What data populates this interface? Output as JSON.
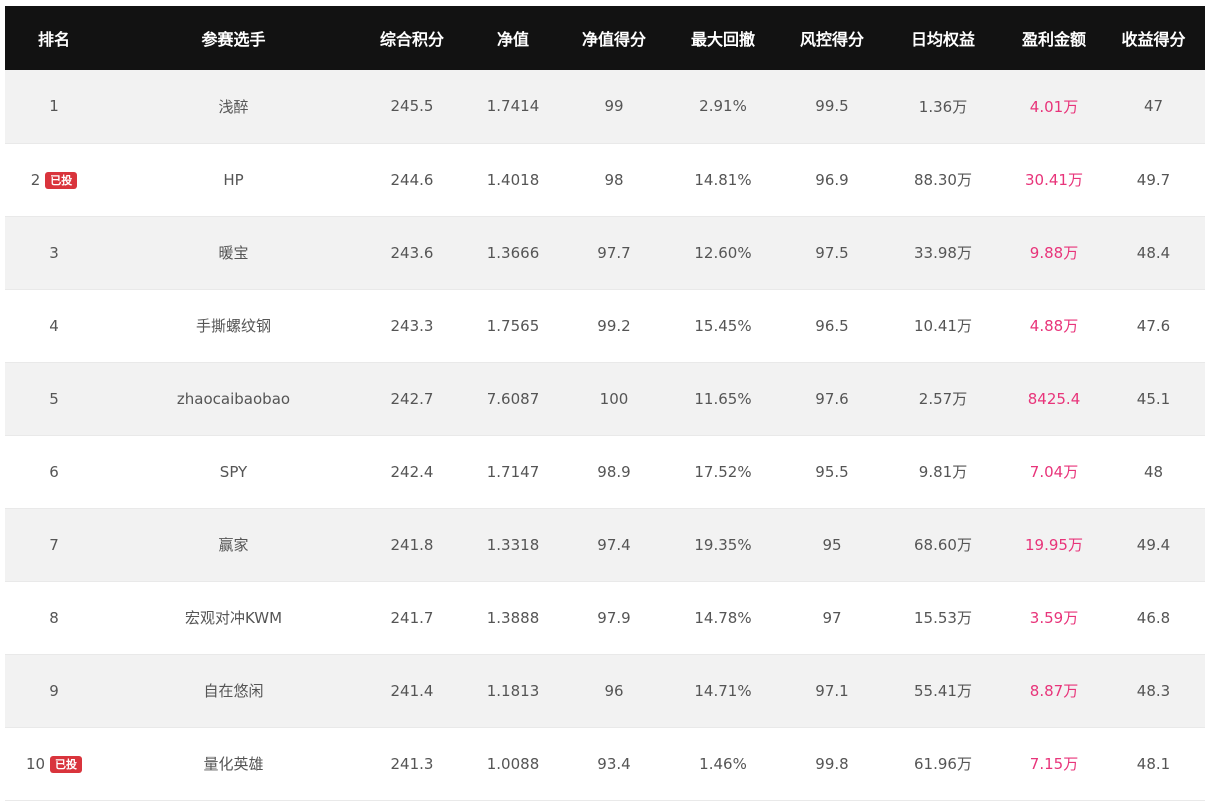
{
  "table": {
    "headers": [
      "排名",
      "参赛选手",
      "综合积分",
      "净值",
      "净值得分",
      "最大回撤",
      "风控得分",
      "日均权益",
      "盈利金额",
      "收益得分"
    ],
    "badge_label": "已投",
    "accent_colors": {
      "header_bg": "#121212",
      "profit_text": "#e8347a",
      "badge_bg": "#d9343c"
    },
    "rows": [
      {
        "rank": "1",
        "badge": "",
        "name": "浅醉",
        "score": "245.5",
        "nav": "1.7414",
        "nav_score": "99",
        "max_drawdown": "2.91%",
        "risk_score": "99.5",
        "avg_equity": "1.36万",
        "profit": "4.01万",
        "return_score": "47"
      },
      {
        "rank": "2",
        "badge": "已投",
        "name": "HP",
        "score": "244.6",
        "nav": "1.4018",
        "nav_score": "98",
        "max_drawdown": "14.81%",
        "risk_score": "96.9",
        "avg_equity": "88.30万",
        "profit": "30.41万",
        "return_score": "49.7"
      },
      {
        "rank": "3",
        "badge": "",
        "name": "暖宝",
        "score": "243.6",
        "nav": "1.3666",
        "nav_score": "97.7",
        "max_drawdown": "12.60%",
        "risk_score": "97.5",
        "avg_equity": "33.98万",
        "profit": "9.88万",
        "return_score": "48.4"
      },
      {
        "rank": "4",
        "badge": "",
        "name": "手撕螺纹钢",
        "score": "243.3",
        "nav": "1.7565",
        "nav_score": "99.2",
        "max_drawdown": "15.45%",
        "risk_score": "96.5",
        "avg_equity": "10.41万",
        "profit": "4.88万",
        "return_score": "47.6"
      },
      {
        "rank": "5",
        "badge": "",
        "name": "zhaocaibaobao",
        "score": "242.7",
        "nav": "7.6087",
        "nav_score": "100",
        "max_drawdown": "11.65%",
        "risk_score": "97.6",
        "avg_equity": "2.57万",
        "profit": "8425.4",
        "return_score": "45.1"
      },
      {
        "rank": "6",
        "badge": "",
        "name": "SPY",
        "score": "242.4",
        "nav": "1.7147",
        "nav_score": "98.9",
        "max_drawdown": "17.52%",
        "risk_score": "95.5",
        "avg_equity": "9.81万",
        "profit": "7.04万",
        "return_score": "48"
      },
      {
        "rank": "7",
        "badge": "",
        "name": "赢家",
        "score": "241.8",
        "nav": "1.3318",
        "nav_score": "97.4",
        "max_drawdown": "19.35%",
        "risk_score": "95",
        "avg_equity": "68.60万",
        "profit": "19.95万",
        "return_score": "49.4"
      },
      {
        "rank": "8",
        "badge": "",
        "name": "宏观对冲KWM",
        "score": "241.7",
        "nav": "1.3888",
        "nav_score": "97.9",
        "max_drawdown": "14.78%",
        "risk_score": "97",
        "avg_equity": "15.53万",
        "profit": "3.59万",
        "return_score": "46.8"
      },
      {
        "rank": "9",
        "badge": "",
        "name": "自在悠闲",
        "score": "241.4",
        "nav": "1.1813",
        "nav_score": "96",
        "max_drawdown": "14.71%",
        "risk_score": "97.1",
        "avg_equity": "55.41万",
        "profit": "8.87万",
        "return_score": "48.3"
      },
      {
        "rank": "10",
        "badge": "已投",
        "name": "量化英雄",
        "score": "241.3",
        "nav": "1.0088",
        "nav_score": "93.4",
        "max_drawdown": "1.46%",
        "risk_score": "99.8",
        "avg_equity": "61.96万",
        "profit": "7.15万",
        "return_score": "48.1"
      }
    ]
  }
}
